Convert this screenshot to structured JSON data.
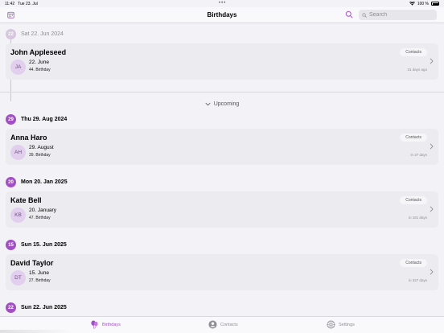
{
  "status_bar": {
    "time": "11:42",
    "date": "Tue 23. Jul",
    "battery": "100 %"
  },
  "nav": {
    "title": "Birthdays",
    "search_placeholder": "Search"
  },
  "upcoming_label": "Upcoming",
  "sections": [
    {
      "day": "22",
      "date": "Sat 22. Jun 2024",
      "past": true,
      "card": {
        "name": "John Appleseed",
        "initials": "JA",
        "date": "22. June",
        "age": "44. Birthday",
        "badge": "Contacts",
        "relative": "31 days ago"
      }
    },
    {
      "day": "29",
      "date": "Thu 29. Aug 2024",
      "past": false,
      "card": {
        "name": "Anna Haro",
        "initials": "AH",
        "date": "29. August",
        "age": "39. Birthday",
        "badge": "Contacts",
        "relative": "in 37 days"
      }
    },
    {
      "day": "20",
      "date": "Mon 20. Jan 2025",
      "past": false,
      "card": {
        "name": "Kate Bell",
        "initials": "KB",
        "date": "20. January",
        "age": "47. Birthday",
        "badge": "Contacts",
        "relative": "in 181 days"
      }
    },
    {
      "day": "15",
      "date": "Sun 15. Jun 2025",
      "past": false,
      "card": {
        "name": "David Taylor",
        "initials": "DT",
        "date": "15. June",
        "age": "27. Birthday",
        "badge": "Contacts",
        "relative": "in 327 days"
      }
    },
    {
      "day": "22",
      "date": "Sun 22. Jun 2025",
      "past": false
    }
  ],
  "tabs": [
    {
      "label": "Birthdays",
      "icon": "balloon-icon",
      "active": true
    },
    {
      "label": "Contacts",
      "icon": "person-circle-icon",
      "active": false
    },
    {
      "label": "Settings",
      "icon": "gear-icon",
      "active": false
    }
  ],
  "colors": {
    "accent": "#a24fc6",
    "background": "#f2f2f7",
    "card": "#ebebf0",
    "avatar": "#e2cfee"
  }
}
